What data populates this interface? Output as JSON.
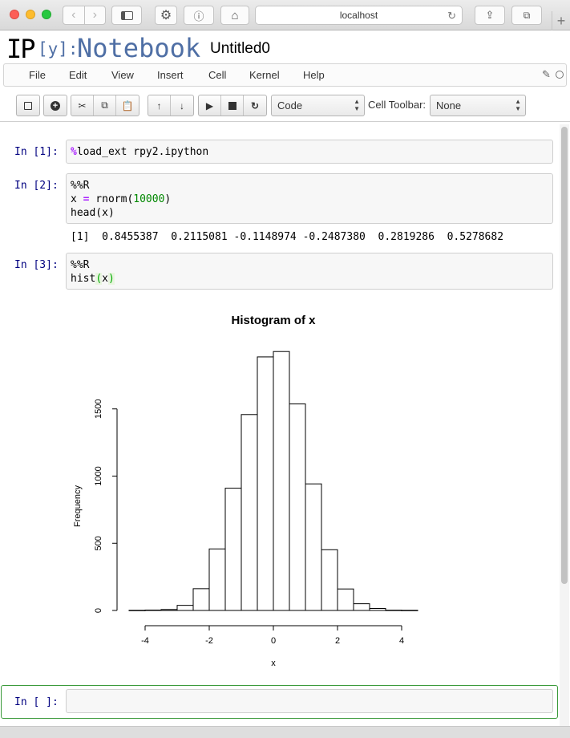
{
  "browser": {
    "url": "localhost"
  },
  "notebook": {
    "logo_ip": "IP",
    "logo_y": "[y]:",
    "logo_nb": "Notebook",
    "name": "Untitled0"
  },
  "menu": [
    "File",
    "Edit",
    "View",
    "Insert",
    "Cell",
    "Kernel",
    "Help"
  ],
  "toolbar": {
    "cell_type": "Code",
    "cell_toolbar_label": "Cell Toolbar:",
    "cell_toolbar_value": "None"
  },
  "cells": [
    {
      "prompt": "In [1]:",
      "magic": "%",
      "code": "load_ext rpy2.ipython"
    },
    {
      "prompt": "In [2]:",
      "line1": "%%R",
      "line2a": "x ",
      "line2op": "=",
      "line2b": " rnorm(",
      "line2num": "10000",
      "line2c": ")",
      "line3": "head(x)",
      "output": "[1]  0.8455387  0.2115081 -0.1148974 -0.2487380  0.2819286  0.5278682"
    },
    {
      "prompt": "In [3]:",
      "line1": "%%R",
      "line2a": "hist",
      "line2p1": "(",
      "line2b": "x",
      "line2p2": ")"
    },
    {
      "prompt": "In [ ]:"
    }
  ],
  "chart_data": {
    "type": "bar",
    "title": "Histogram of x",
    "xlabel": "x",
    "ylabel": "Frequency",
    "bins": [
      [
        -4.5,
        -4
      ],
      [
        -4,
        -3.5
      ],
      [
        -3.5,
        -3
      ],
      [
        -3,
        -2.5
      ],
      [
        -2.5,
        -2
      ],
      [
        -2,
        -1.5
      ],
      [
        -1.5,
        -1
      ],
      [
        -1,
        -0.5
      ],
      [
        -0.5,
        0
      ],
      [
        0,
        0.5
      ],
      [
        0.5,
        1
      ],
      [
        1,
        1.5
      ],
      [
        1.5,
        2
      ],
      [
        2,
        2.5
      ],
      [
        2.5,
        3
      ],
      [
        3,
        3.5
      ],
      [
        3.5,
        4
      ],
      [
        4,
        4.5
      ]
    ],
    "values": [
      1,
      3,
      7,
      38,
      162,
      458,
      910,
      1458,
      1887,
      1927,
      1537,
      942,
      452,
      160,
      50,
      15,
      2,
      1
    ],
    "xticks": [
      -4,
      -2,
      0,
      2,
      4
    ],
    "yticks": [
      0,
      500,
      1000,
      1500
    ],
    "xlim": [
      -4.5,
      4.5
    ],
    "ylim": [
      0,
      1927
    ]
  }
}
